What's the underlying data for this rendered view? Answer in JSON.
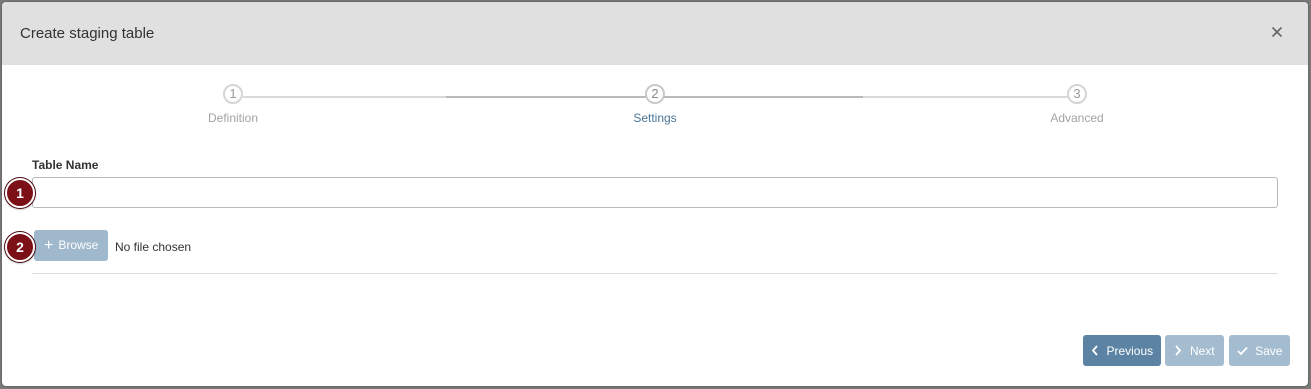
{
  "dialog": {
    "title": "Create staging table",
    "close_icon": "close-icon"
  },
  "stepper": {
    "steps": [
      {
        "number": "1",
        "label": "Definition",
        "state": "done"
      },
      {
        "number": "2",
        "label": "Settings",
        "state": "active"
      },
      {
        "number": "3",
        "label": "Advanced",
        "state": "pending"
      }
    ],
    "colors": {
      "line": "#d9d9d9",
      "active_line": "#b9b9b9",
      "active_label": "#4a7596"
    }
  },
  "form": {
    "table_name_label": "Table Name",
    "table_name_value": "",
    "browse_label": "Browse",
    "browse_icon": "plus-icon",
    "file_status": "No file chosen"
  },
  "annotations": {
    "badge_1": "1",
    "badge_2": "2",
    "badge_color": "#7b1117"
  },
  "footer": {
    "previous_label": "Previous",
    "next_label": "Next",
    "save_label": "Save",
    "previous_icon": "chevron-left-icon",
    "next_icon": "chevron-right-icon",
    "save_icon": "check-icon"
  }
}
